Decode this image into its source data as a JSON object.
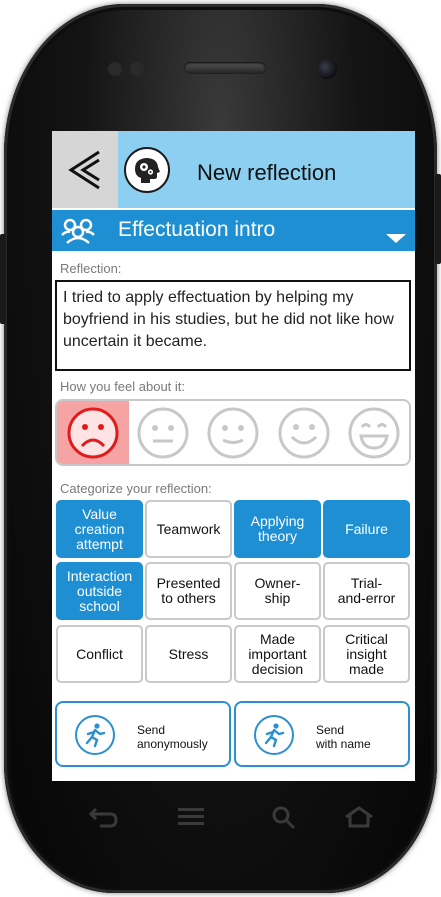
{
  "app": {
    "title": "New reflection",
    "back_icon": "chevron-left-icon",
    "logo_icon": "brain-gears-icon"
  },
  "group_selector": {
    "label": "Effectuation intro",
    "icon": "group-icon"
  },
  "reflection": {
    "label": "Reflection:",
    "text": "I tried to apply effectuation by helping my boyfriend in his studies, but he did not like how uncertain it became."
  },
  "mood": {
    "label": "How you feel about it:",
    "options": [
      "very-sad-face-icon",
      "neutral-face-icon",
      "slight-smile-face-icon",
      "smile-face-icon",
      "big-grin-face-icon"
    ],
    "selected": 0
  },
  "categories": {
    "label": "Categorize your reflection:",
    "items": [
      {
        "label": "Value\ncreation\nattempt",
        "selected": true
      },
      {
        "label": "Teamwork",
        "selected": false
      },
      {
        "label": "Applying\ntheory",
        "selected": true
      },
      {
        "label": "Failure",
        "selected": true
      },
      {
        "label": "Interaction\noutside\nschool",
        "selected": true
      },
      {
        "label": "Presented\nto others",
        "selected": false
      },
      {
        "label": "Owner-\nship",
        "selected": false
      },
      {
        "label": "Trial-\nand-error",
        "selected": false
      },
      {
        "label": "Conflict",
        "selected": false
      },
      {
        "label": "Stress",
        "selected": false
      },
      {
        "label": "Made\nimportant\ndecision",
        "selected": false
      },
      {
        "label": "Critical\ninsight\nmade",
        "selected": false
      }
    ]
  },
  "send": {
    "anonymous": {
      "line1": "Send",
      "line2": "anonymously",
      "icon": "running-person-icon"
    },
    "named": {
      "line1": "Send",
      "line2": "with name",
      "icon": "running-person-icon"
    }
  },
  "navbar": {
    "icons": [
      "back-arrow-icon",
      "menu-icon",
      "search-icon",
      "home-icon"
    ]
  },
  "colors": {
    "appbar": "#8dcff1",
    "accent": "#1e8fd2",
    "selected_mood": "#f5a3a3",
    "mood_face": "#e11b1b",
    "mood_inactive": "#c8c8c8"
  }
}
